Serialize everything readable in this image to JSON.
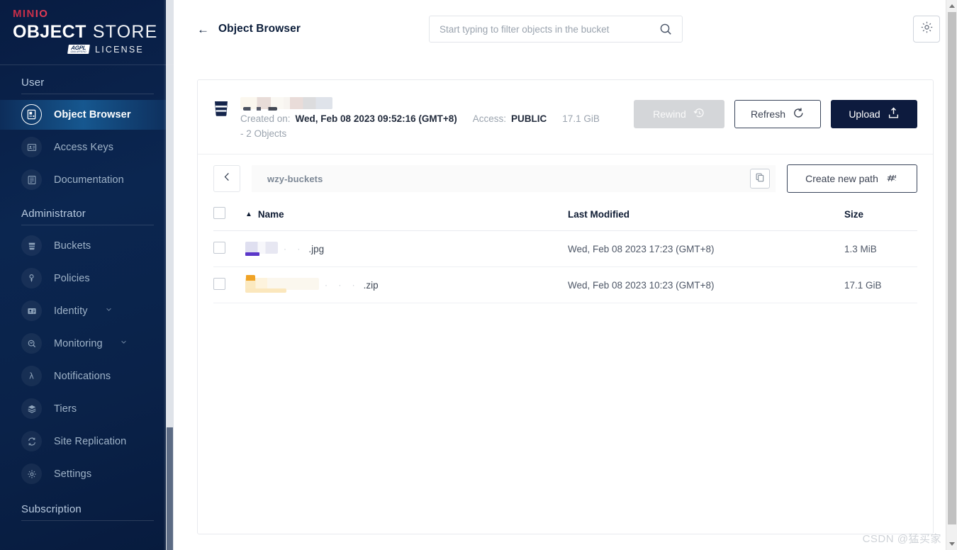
{
  "sidebar": {
    "logo": {
      "min": "MIN",
      "io": "IO",
      "object": "OBJECT",
      "store": "STORE",
      "agpl": "AGPL",
      "agpl_sub": "GNU AFFERO",
      "license": "LICENSE"
    },
    "sections": [
      {
        "title": "User",
        "items": [
          {
            "label": "Object Browser",
            "icon": "object-browser-icon",
            "active": true,
            "chevron": false
          },
          {
            "label": "Access Keys",
            "icon": "access-keys-icon",
            "active": false,
            "chevron": false
          },
          {
            "label": "Documentation",
            "icon": "documentation-icon",
            "active": false,
            "chevron": false
          }
        ]
      },
      {
        "title": "Administrator",
        "items": [
          {
            "label": "Buckets",
            "icon": "buckets-icon",
            "active": false,
            "chevron": false
          },
          {
            "label": "Policies",
            "icon": "policies-icon",
            "active": false,
            "chevron": false
          },
          {
            "label": "Identity",
            "icon": "identity-icon",
            "active": false,
            "chevron": true
          },
          {
            "label": "Monitoring",
            "icon": "monitoring-icon",
            "active": false,
            "chevron": true
          },
          {
            "label": "Notifications",
            "icon": "notifications-icon",
            "active": false,
            "chevron": false
          },
          {
            "label": "Tiers",
            "icon": "tiers-icon",
            "active": false,
            "chevron": false
          },
          {
            "label": "Site Replication",
            "icon": "site-replication-icon",
            "active": false,
            "chevron": false
          },
          {
            "label": "Settings",
            "icon": "settings-icon",
            "active": false,
            "chevron": false
          }
        ]
      },
      {
        "title": "Subscription",
        "items": []
      }
    ]
  },
  "header": {
    "back_arrow": "←",
    "title": "Object Browser",
    "search_placeholder": "Start typing to filter objects in the bucket",
    "search_value": "",
    "search_icon": "search-icon",
    "settings_icon": "gear-icon"
  },
  "bucket": {
    "name": "",
    "name_redacted": true,
    "created_label": "Created on:",
    "created_value": "Wed, Feb 08 2023 09:52:16 (GMT+8)",
    "access_label": "Access:",
    "access_value": "PUBLIC",
    "size": "17.1 GiB",
    "objects_line": "- 2 Objects",
    "actions": {
      "rewind": "Rewind",
      "rewind_disabled": true,
      "refresh": "Refresh",
      "upload": "Upload"
    }
  },
  "pathbar": {
    "back_icon": "chevron-left-icon",
    "path": "wzy-buckets",
    "copy_icon": "copy-icon",
    "create_new_path": "Create new path"
  },
  "table": {
    "columns": [
      "Name",
      "Last Modified",
      "Size"
    ],
    "sort_column": "Name",
    "sort_direction": "asc",
    "rows": [
      {
        "name_redacted": true,
        "extension": ".jpg",
        "icon": "jpg-file-icon",
        "last_modified": "Wed, Feb 08 2023 17:23 (GMT+8)",
        "size": "1.3 MiB",
        "selected": false
      },
      {
        "name_redacted": true,
        "extension": ".zip",
        "icon": "zip-file-icon",
        "last_modified": "Wed, Feb 08 2023 10:23 (GMT+8)",
        "size": "17.1 GiB",
        "selected": false
      }
    ]
  },
  "watermark": "CSDN @猛买家",
  "colors": {
    "sidebar_dark": "#081c42",
    "sidebar_active": "#16578f",
    "brand_red": "#c72e49",
    "upload_navy": "#0d1b3e",
    "text_dark": "#0b1d3a",
    "muted": "#9aa3ae"
  }
}
